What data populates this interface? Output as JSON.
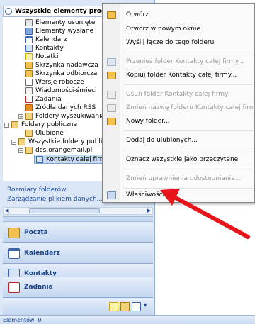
{
  "tree_header": {
    "title": "Wszystkie elementy programu Outlook"
  },
  "tree": [
    {
      "label": "Elementy usunięte",
      "icon": "deleted-items-icon"
    },
    {
      "label": "Elementy wysłane",
      "icon": "sent-items-icon"
    },
    {
      "label": "Kalendarz",
      "icon": "calendar-icon"
    },
    {
      "label": "Kontakty",
      "icon": "contacts-icon"
    },
    {
      "label": "Notatki",
      "icon": "notes-icon"
    },
    {
      "label": "Skrzynka nadawcza",
      "icon": "outbox-icon"
    },
    {
      "label": "Skrzynka odbiorcza",
      "icon": "inbox-icon"
    },
    {
      "label": "Wersje robocze",
      "icon": "drafts-icon"
    },
    {
      "label": "Wiadomości-śmieci",
      "icon": "junk-mail-icon"
    },
    {
      "label": "Zadania",
      "icon": "tasks-icon"
    },
    {
      "label": "Źródła danych RSS",
      "icon": "rss-feeds-icon"
    },
    {
      "label": "Foldery wyszukiwania",
      "icon": "search-folders-icon"
    },
    {
      "label": "Foldery publiczne",
      "icon": "public-folders-icon"
    },
    {
      "label": "Ulubione",
      "icon": "favorites-icon"
    },
    {
      "label": "Wszystkie foldery publiczne",
      "icon": "folder-icon"
    },
    {
      "label": "dcs.orangemail.pl",
      "icon": "folder-icon"
    },
    {
      "label": "Kontakty całej firmy",
      "icon": "contacts-folder-icon"
    }
  ],
  "links": {
    "folder_sizes": "Rozmiary folderów",
    "manage_data": "Zarządzanie plikiem danych..."
  },
  "nav_buttons": [
    {
      "label": "Poczta",
      "icon": "mail-icon"
    },
    {
      "label": "Kalendarz",
      "icon": "calendar-icon"
    },
    {
      "label": "Kontakty",
      "icon": "contacts-icon"
    },
    {
      "label": "Zadania",
      "icon": "tasks-icon"
    }
  ],
  "status_bar": {
    "text": "Elementów: 0"
  },
  "context_menu": {
    "items": [
      {
        "label": "Otwórz",
        "enabled": true
      },
      {
        "label": "Otwórz w nowym oknie",
        "enabled": true
      },
      {
        "label": "Wyślij łącze do tego folderu",
        "enabled": true
      },
      {
        "label": "Przenieś folder Kontakty całej firmy...",
        "enabled": false
      },
      {
        "label": "Kopiuj folder Kontakty całej firmy...",
        "enabled": true
      },
      {
        "label": "Usuń folder Kontakty całej firmy",
        "enabled": false
      },
      {
        "label": "Zmień nazwę folderu Kontakty całej firmy...",
        "enabled": false
      },
      {
        "label": "Nowy folder...",
        "enabled": true
      },
      {
        "label": "Dodaj do ulubionych...",
        "enabled": true
      },
      {
        "label": "Oznacz wszystkie jako przeczytane",
        "enabled": true
      },
      {
        "label": "Zmień uprawnienia udostępniania...",
        "enabled": false
      },
      {
        "label": "Właściwości",
        "enabled": true
      }
    ]
  },
  "colors": {
    "nav_background": "#dbe7f6",
    "menu_background": "#fafafa",
    "arrow": "#e8141b",
    "link": "#1f4ea0"
  }
}
